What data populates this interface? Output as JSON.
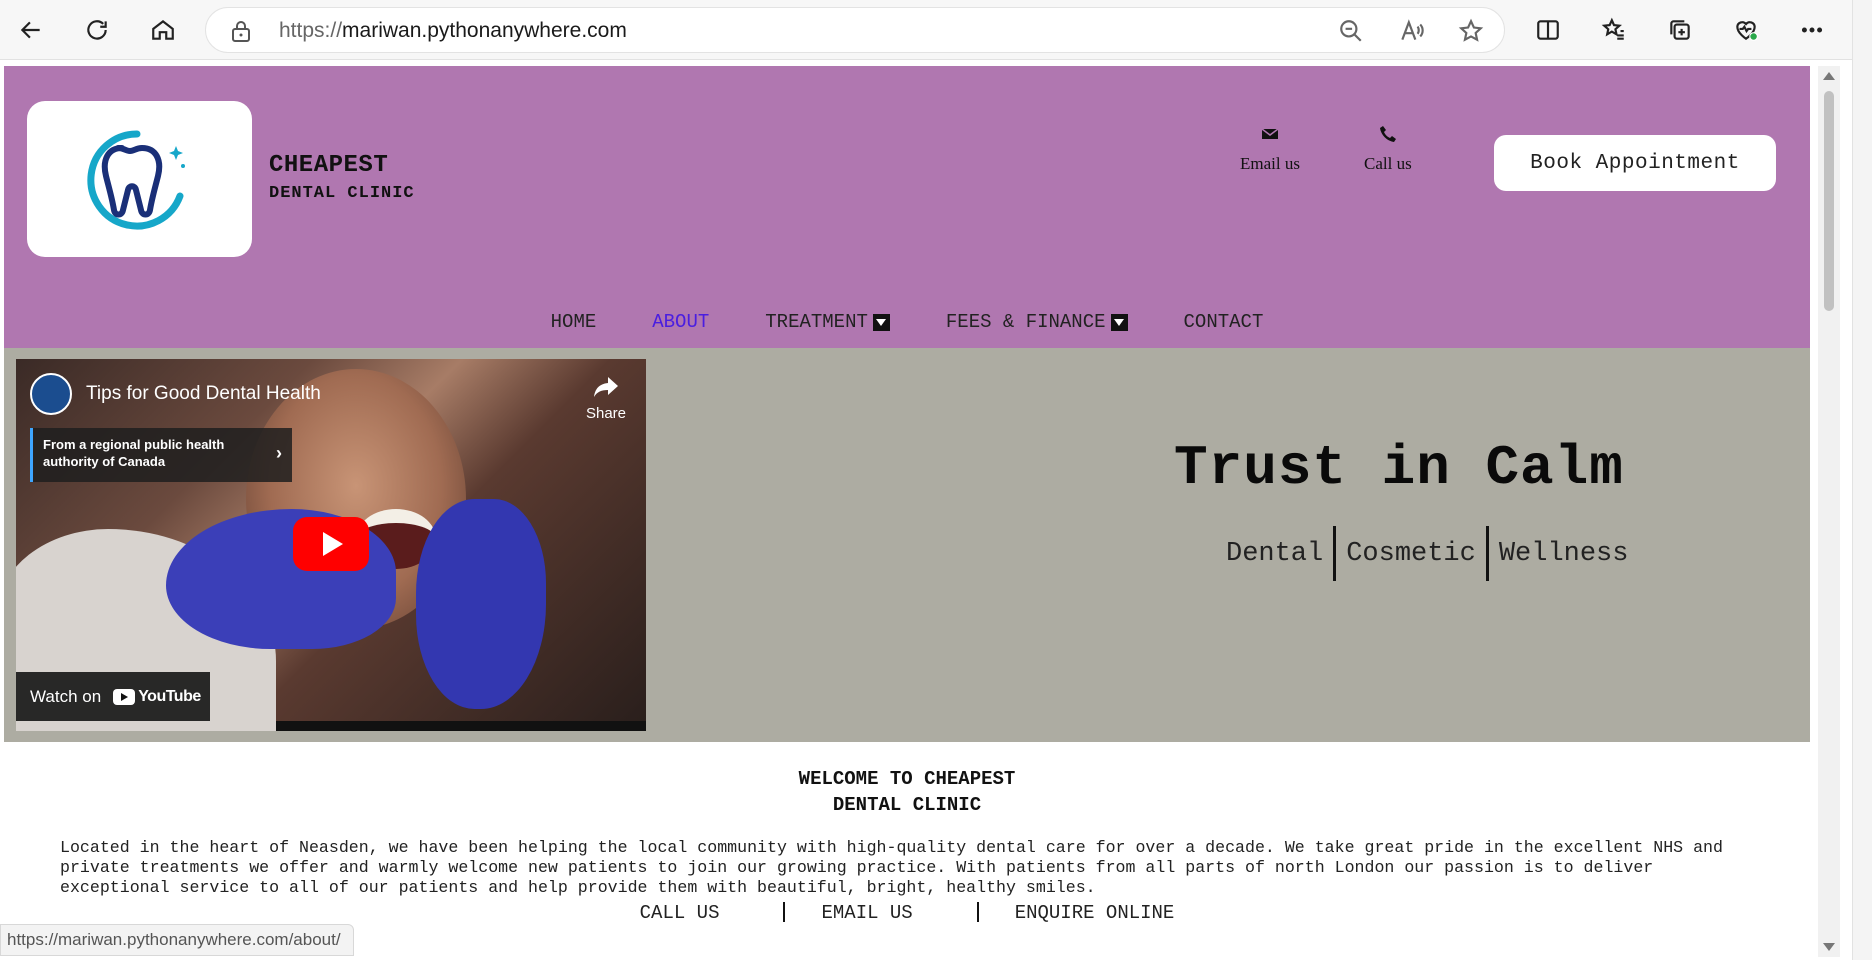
{
  "browser": {
    "url_prefix": "https://",
    "url_host": "mariwan.pythonanywhere.com",
    "status_link": "https://mariwan.pythonanywhere.com/about/"
  },
  "header": {
    "brand_title": "CHEAPEST",
    "brand_subtitle": "DENTAL CLINIC",
    "email_label": "Email us",
    "call_label": "Call us",
    "book_button": "Book Appointment",
    "header_bg": "#b077b0"
  },
  "nav": {
    "items": [
      {
        "label": "HOME"
      },
      {
        "label": "ABOUT"
      },
      {
        "label": "TREATMENT"
      },
      {
        "label": "FEES & FINANCE"
      },
      {
        "label": "CONTACT"
      }
    ]
  },
  "video": {
    "title": "Tips for Good Dental Health",
    "share_label": "Share",
    "info_text": "From a regional public health authority of Canada",
    "watch_on": "Watch on",
    "youtube": "YouTube"
  },
  "hero": {
    "title": "Trust in Calm",
    "tags": [
      "Dental",
      "Cosmetic",
      "Wellness"
    ],
    "hero_bg": "#adaca2"
  },
  "welcome": {
    "title_line1": "WELCOME TO CHEAPEST",
    "title_line2": "DENTAL CLINIC",
    "paragraph": "Located in the heart of Neasden, we have been helping the local community with high-quality dental care for over a decade. We take great pride in the excellent NHS and private treatments we offer and warmly welcome new patients to join our growing practice. With patients from all parts of north London our passion is to deliver exceptional service to all of our patients and help provide them with beautiful, bright, healthy smiles."
  },
  "cta": {
    "call": "CALL US",
    "email": "EMAIL US",
    "enquire": "ENQUIRE ONLINE"
  }
}
